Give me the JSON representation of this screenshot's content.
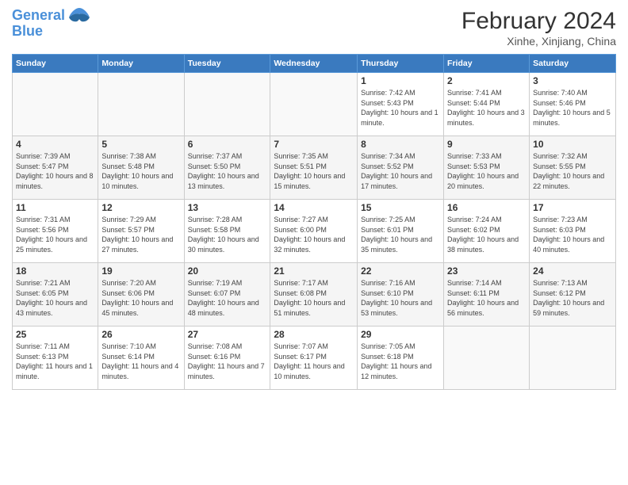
{
  "logo": {
    "line1": "General",
    "line2": "Blue"
  },
  "header": {
    "title": "February 2024",
    "subtitle": "Xinhe, Xinjiang, China"
  },
  "weekdays": [
    "Sunday",
    "Monday",
    "Tuesday",
    "Wednesday",
    "Thursday",
    "Friday",
    "Saturday"
  ],
  "weeks": [
    [
      {
        "day": "",
        "info": ""
      },
      {
        "day": "",
        "info": ""
      },
      {
        "day": "",
        "info": ""
      },
      {
        "day": "",
        "info": ""
      },
      {
        "day": "1",
        "info": "Sunrise: 7:42 AM\nSunset: 5:43 PM\nDaylight: 10 hours and 1 minute."
      },
      {
        "day": "2",
        "info": "Sunrise: 7:41 AM\nSunset: 5:44 PM\nDaylight: 10 hours and 3 minutes."
      },
      {
        "day": "3",
        "info": "Sunrise: 7:40 AM\nSunset: 5:46 PM\nDaylight: 10 hours and 5 minutes."
      }
    ],
    [
      {
        "day": "4",
        "info": "Sunrise: 7:39 AM\nSunset: 5:47 PM\nDaylight: 10 hours and 8 minutes."
      },
      {
        "day": "5",
        "info": "Sunrise: 7:38 AM\nSunset: 5:48 PM\nDaylight: 10 hours and 10 minutes."
      },
      {
        "day": "6",
        "info": "Sunrise: 7:37 AM\nSunset: 5:50 PM\nDaylight: 10 hours and 13 minutes."
      },
      {
        "day": "7",
        "info": "Sunrise: 7:35 AM\nSunset: 5:51 PM\nDaylight: 10 hours and 15 minutes."
      },
      {
        "day": "8",
        "info": "Sunrise: 7:34 AM\nSunset: 5:52 PM\nDaylight: 10 hours and 17 minutes."
      },
      {
        "day": "9",
        "info": "Sunrise: 7:33 AM\nSunset: 5:53 PM\nDaylight: 10 hours and 20 minutes."
      },
      {
        "day": "10",
        "info": "Sunrise: 7:32 AM\nSunset: 5:55 PM\nDaylight: 10 hours and 22 minutes."
      }
    ],
    [
      {
        "day": "11",
        "info": "Sunrise: 7:31 AM\nSunset: 5:56 PM\nDaylight: 10 hours and 25 minutes."
      },
      {
        "day": "12",
        "info": "Sunrise: 7:29 AM\nSunset: 5:57 PM\nDaylight: 10 hours and 27 minutes."
      },
      {
        "day": "13",
        "info": "Sunrise: 7:28 AM\nSunset: 5:58 PM\nDaylight: 10 hours and 30 minutes."
      },
      {
        "day": "14",
        "info": "Sunrise: 7:27 AM\nSunset: 6:00 PM\nDaylight: 10 hours and 32 minutes."
      },
      {
        "day": "15",
        "info": "Sunrise: 7:25 AM\nSunset: 6:01 PM\nDaylight: 10 hours and 35 minutes."
      },
      {
        "day": "16",
        "info": "Sunrise: 7:24 AM\nSunset: 6:02 PM\nDaylight: 10 hours and 38 minutes."
      },
      {
        "day": "17",
        "info": "Sunrise: 7:23 AM\nSunset: 6:03 PM\nDaylight: 10 hours and 40 minutes."
      }
    ],
    [
      {
        "day": "18",
        "info": "Sunrise: 7:21 AM\nSunset: 6:05 PM\nDaylight: 10 hours and 43 minutes."
      },
      {
        "day": "19",
        "info": "Sunrise: 7:20 AM\nSunset: 6:06 PM\nDaylight: 10 hours and 45 minutes."
      },
      {
        "day": "20",
        "info": "Sunrise: 7:19 AM\nSunset: 6:07 PM\nDaylight: 10 hours and 48 minutes."
      },
      {
        "day": "21",
        "info": "Sunrise: 7:17 AM\nSunset: 6:08 PM\nDaylight: 10 hours and 51 minutes."
      },
      {
        "day": "22",
        "info": "Sunrise: 7:16 AM\nSunset: 6:10 PM\nDaylight: 10 hours and 53 minutes."
      },
      {
        "day": "23",
        "info": "Sunrise: 7:14 AM\nSunset: 6:11 PM\nDaylight: 10 hours and 56 minutes."
      },
      {
        "day": "24",
        "info": "Sunrise: 7:13 AM\nSunset: 6:12 PM\nDaylight: 10 hours and 59 minutes."
      }
    ],
    [
      {
        "day": "25",
        "info": "Sunrise: 7:11 AM\nSunset: 6:13 PM\nDaylight: 11 hours and 1 minute."
      },
      {
        "day": "26",
        "info": "Sunrise: 7:10 AM\nSunset: 6:14 PM\nDaylight: 11 hours and 4 minutes."
      },
      {
        "day": "27",
        "info": "Sunrise: 7:08 AM\nSunset: 6:16 PM\nDaylight: 11 hours and 7 minutes."
      },
      {
        "day": "28",
        "info": "Sunrise: 7:07 AM\nSunset: 6:17 PM\nDaylight: 11 hours and 10 minutes."
      },
      {
        "day": "29",
        "info": "Sunrise: 7:05 AM\nSunset: 6:18 PM\nDaylight: 11 hours and 12 minutes."
      },
      {
        "day": "",
        "info": ""
      },
      {
        "day": "",
        "info": ""
      }
    ]
  ]
}
